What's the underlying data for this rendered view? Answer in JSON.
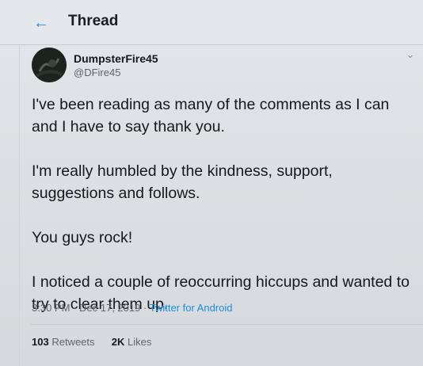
{
  "header": {
    "back_icon": "arrow-left-icon",
    "title": "Thread"
  },
  "tweet": {
    "display_name": "DumpsterFire45",
    "handle": "@DFire45",
    "menu_icon": "chevron-down-icon",
    "paragraphs": [
      "I've been reading as many of the comments as I can and I have to say thank you.",
      "I'm really humbled by the kindness, support, suggestions and follows.",
      "You guys rock!",
      "I noticed a couple of reoccurring hiccups and wanted to try to clear them up."
    ],
    "time": "3:30 PM",
    "separator": "·",
    "date": "Dec 17, 2019",
    "source": "Twitter for Android",
    "retweets_count": "103",
    "retweets_label": "Retweets",
    "likes_count": "2K",
    "likes_label": "Likes"
  },
  "colors": {
    "accent": "#1b8fd8",
    "text": "#16191c",
    "muted": "#5f666d"
  }
}
